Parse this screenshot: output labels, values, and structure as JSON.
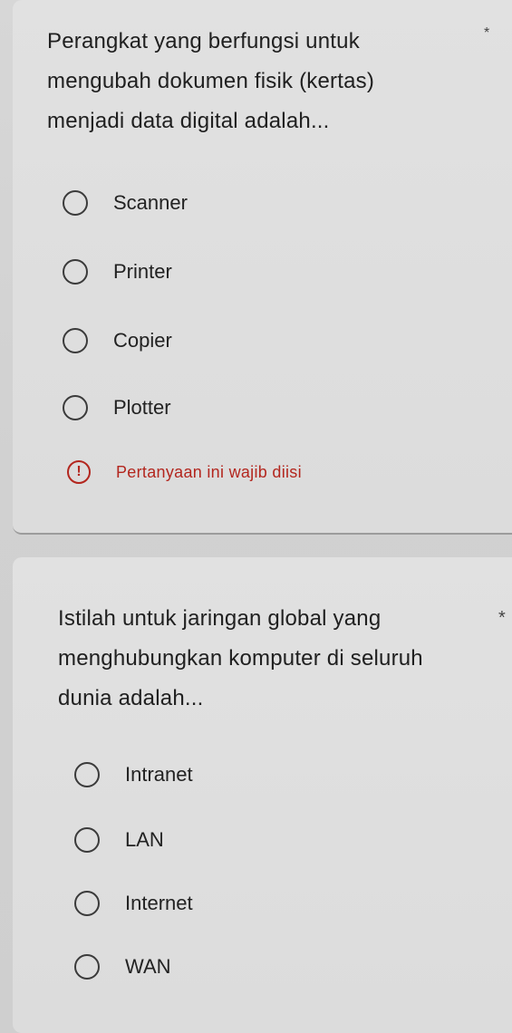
{
  "questions": [
    {
      "text": "Perangkat yang berfungsi untuk mengubah dokumen fisik (kertas) menjadi data digital adalah...",
      "required_marker": "*",
      "options": [
        "Scanner",
        "Printer",
        "Copier",
        "Plotter"
      ],
      "error": {
        "icon": "!",
        "text": "Pertanyaan ini wajib diisi"
      }
    },
    {
      "text": "Istilah untuk jaringan global yang menghubungkan komputer di seluruh dunia adalah...",
      "required_marker": "*",
      "options": [
        "Intranet",
        "LAN",
        "Internet",
        "WAN"
      ]
    }
  ],
  "colors": {
    "error": "#b3261e",
    "text": "#202020",
    "radio_border": "#3a3a3a"
  }
}
